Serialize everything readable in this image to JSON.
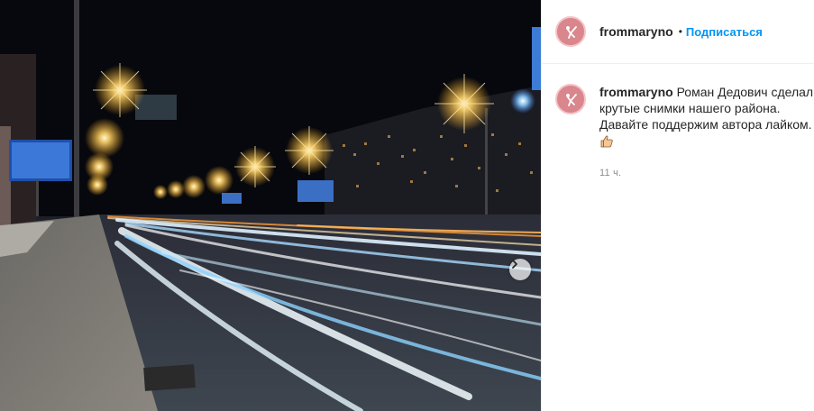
{
  "post": {
    "image_alt": "night road long exposure",
    "header": {
      "username": "frommaryno",
      "separator": "•",
      "follow_label": "Подписаться"
    },
    "caption": {
      "username": "frommaryno",
      "text": "Роман Дедович сделал крутые снимки нашего района. Давайте поддержим автора лайком.",
      "emoji_icon": "thumbs-up-icon",
      "time": "11 ч."
    },
    "colors": {
      "follow_blue": "#0095f6",
      "avatar_bg": "#d9868c",
      "secondary_text": "#8e8e8e"
    }
  }
}
